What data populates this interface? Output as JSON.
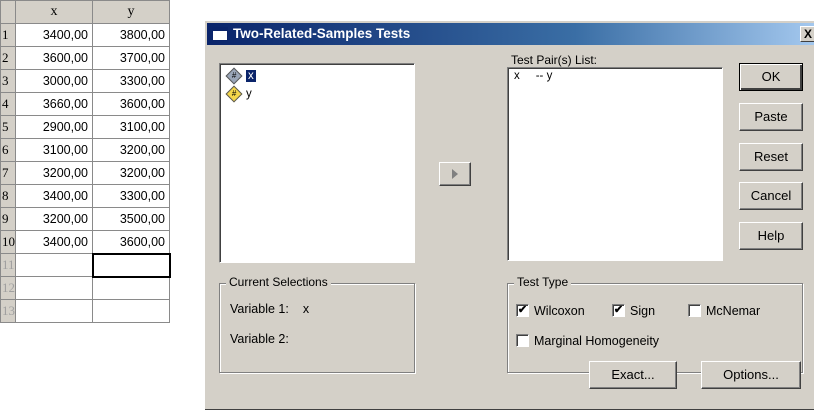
{
  "sheet": {
    "columns": [
      "x",
      "y"
    ],
    "rows": [
      {
        "n": "1",
        "x": "3400,00",
        "y": "3800,00"
      },
      {
        "n": "2",
        "x": "3600,00",
        "y": "3700,00"
      },
      {
        "n": "3",
        "x": "3000,00",
        "y": "3300,00"
      },
      {
        "n": "4",
        "x": "3660,00",
        "y": "3600,00"
      },
      {
        "n": "5",
        "x": "2900,00",
        "y": "3100,00"
      },
      {
        "n": "6",
        "x": "3100,00",
        "y": "3200,00"
      },
      {
        "n": "7",
        "x": "3200,00",
        "y": "3200,00"
      },
      {
        "n": "8",
        "x": "3400,00",
        "y": "3300,00"
      },
      {
        "n": "9",
        "x": "3200,00",
        "y": "3500,00"
      },
      {
        "n": "10",
        "x": "3400,00",
        "y": "3600,00"
      },
      {
        "n": "11",
        "x": "",
        "y": ""
      },
      {
        "n": "12",
        "x": "",
        "y": ""
      },
      {
        "n": "13",
        "x": "",
        "y": ""
      }
    ]
  },
  "dialog": {
    "title": "Two-Related-Samples Tests",
    "close_label": "X",
    "variables": [
      {
        "name": "x",
        "icon": "scale-variable-icon"
      },
      {
        "name": "y",
        "icon": "scale-variable-icon"
      }
    ],
    "move_arrow_icon": "right-arrow-icon",
    "pairs_label": "Test Pair(s) List:",
    "pair_rows": [
      "x     -- y"
    ],
    "buttons": {
      "ok": "OK",
      "paste": "Paste",
      "reset": "Reset",
      "cancel": "Cancel",
      "help": "Help",
      "exact": "Exact...",
      "options": "Options..."
    },
    "current_selections": {
      "title": "Current Selections",
      "var1_label": "Variable 1:",
      "var1_value": "x",
      "var2_label": "Variable 2:",
      "var2_value": ""
    },
    "test_type": {
      "title": "Test Type",
      "wilcoxon": {
        "label": "Wilcoxon",
        "checked": true
      },
      "sign": {
        "label": "Sign",
        "checked": true
      },
      "mcnemar": {
        "label": "McNemar",
        "checked": false
      },
      "marginal": {
        "label": "Marginal Homogeneity",
        "checked": false
      }
    }
  }
}
